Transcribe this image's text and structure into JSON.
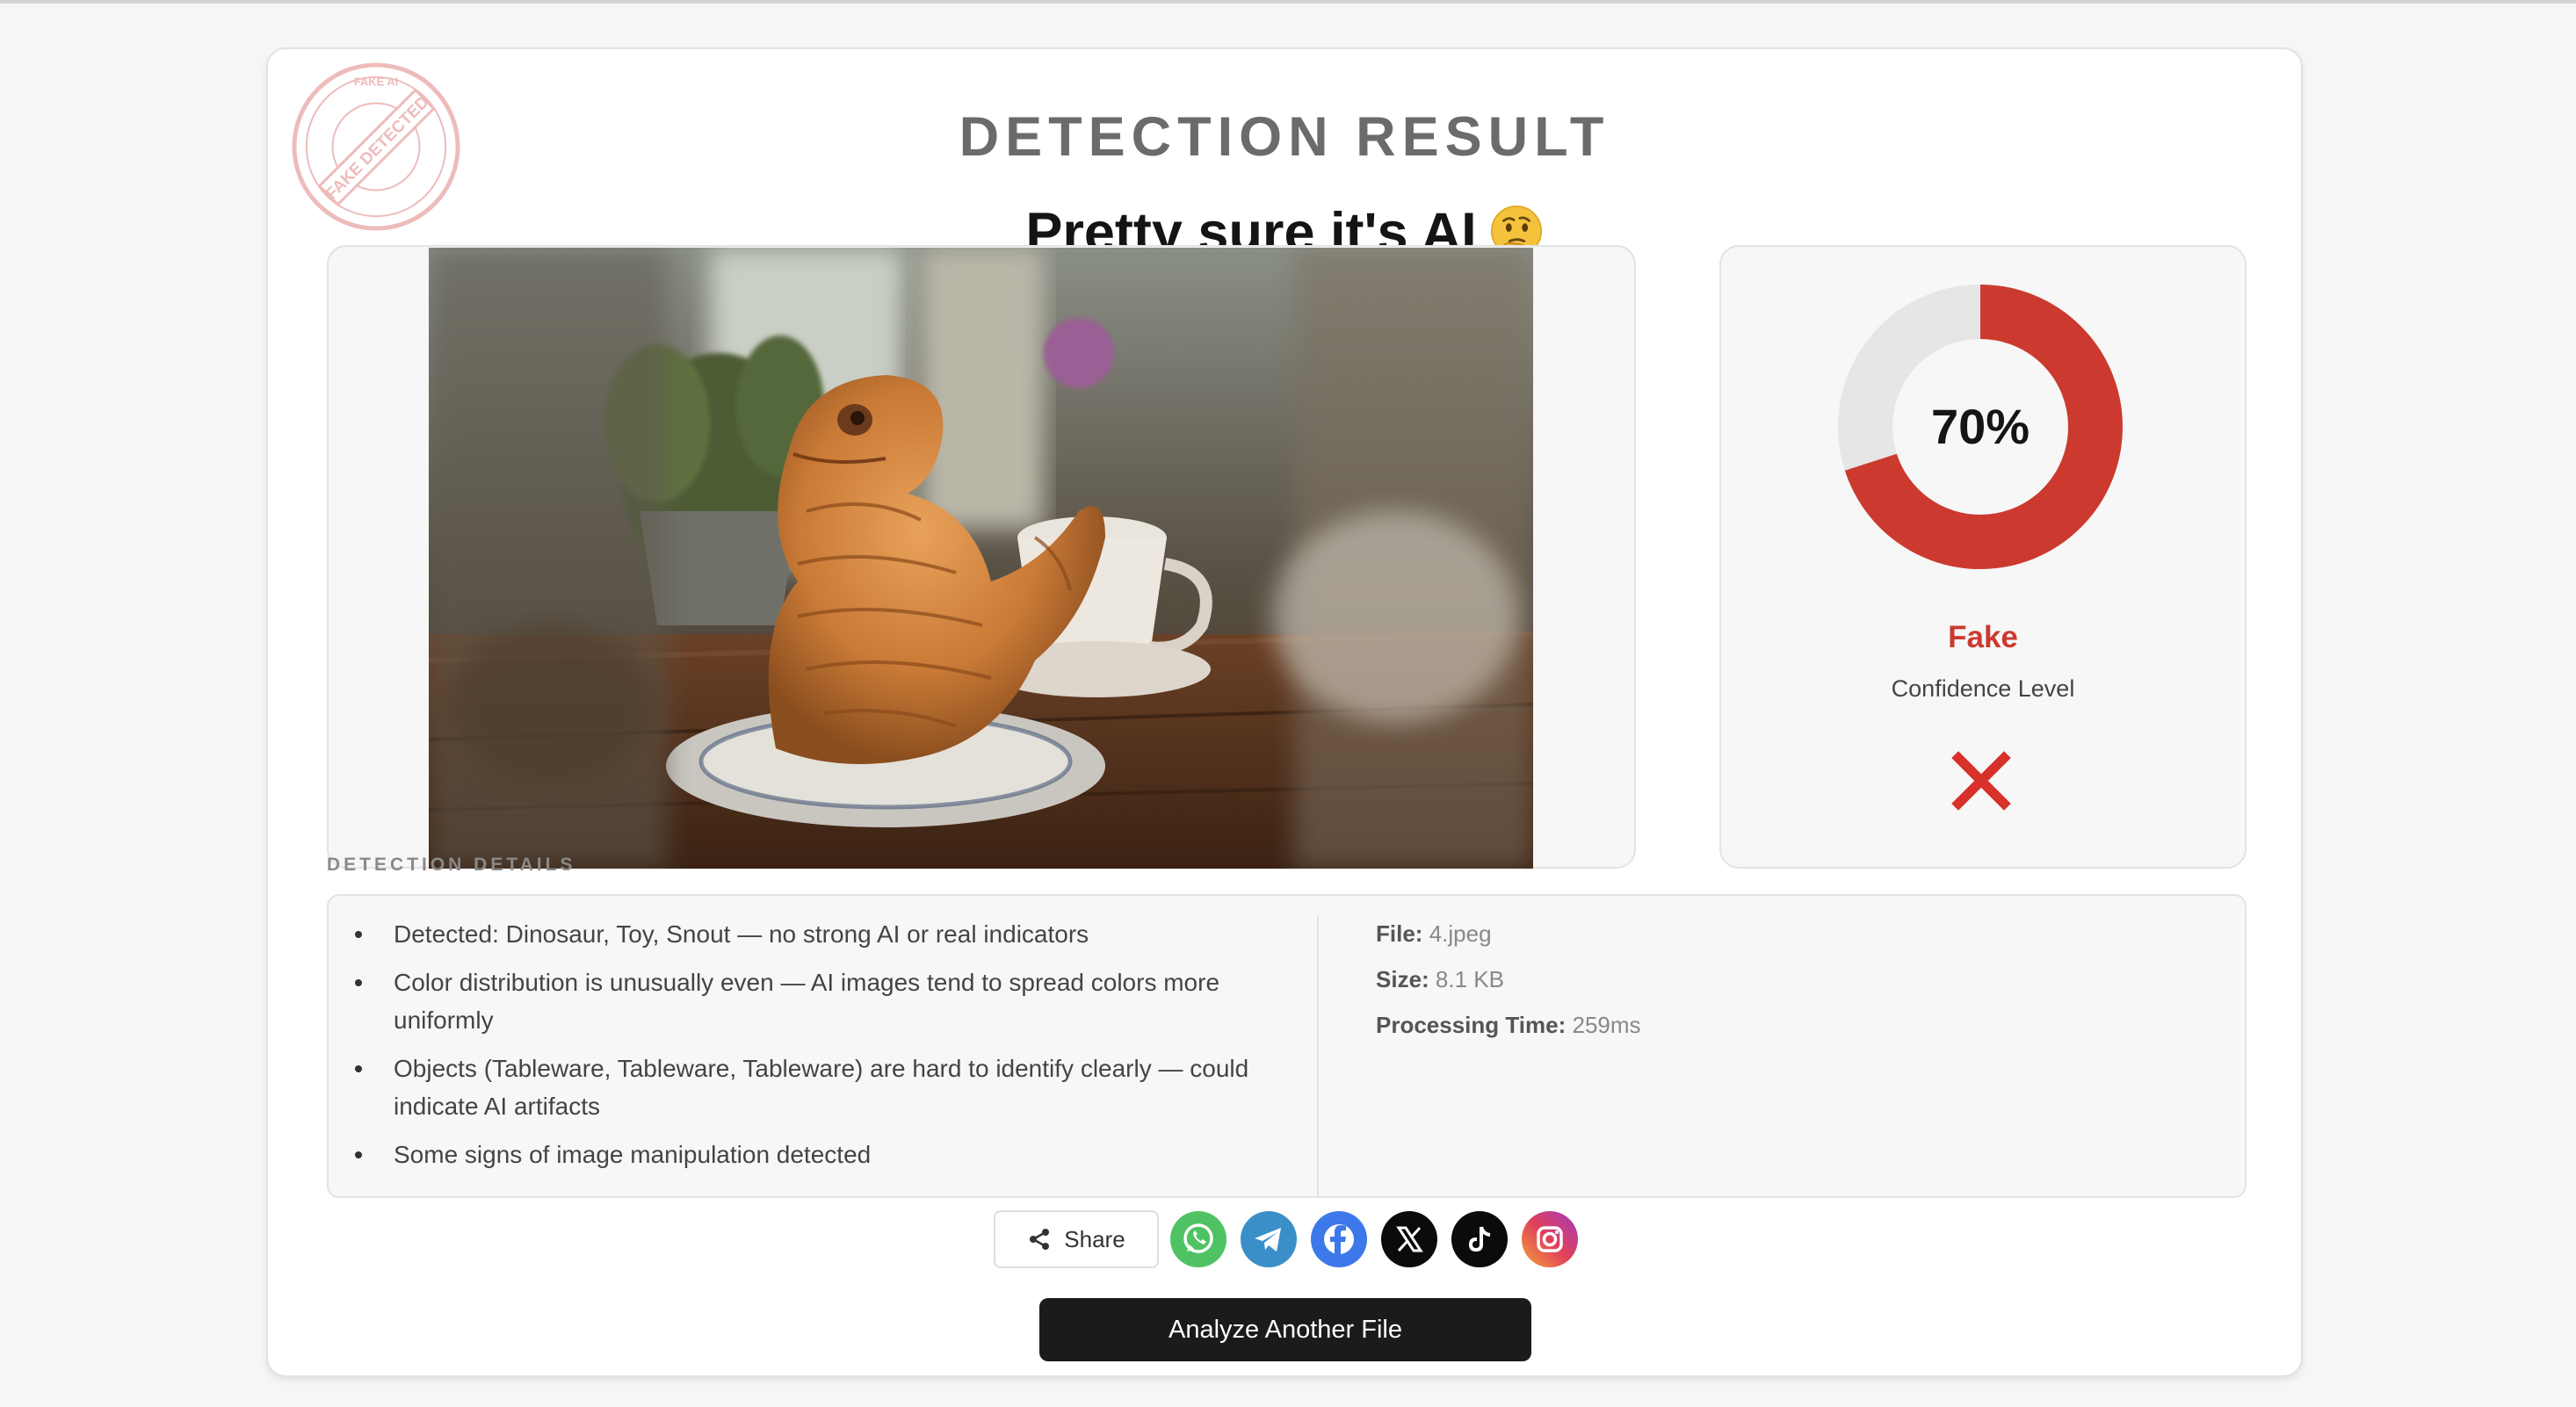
{
  "header": {
    "title": "DETECTION RESULT",
    "verdict": "Pretty sure it's AI"
  },
  "stamp": {
    "text_top": "FAKE AI",
    "text_main": "FAKE DETECTED"
  },
  "confidence": {
    "percent_text": "70%",
    "value": 0.7,
    "label": "Fake",
    "sublabel": "Confidence Level",
    "accent_color": "#cc3a2f",
    "track_color": "#e6e6e6"
  },
  "details": {
    "heading": "DETECTION DETAILS",
    "items": [
      "Detected: Dinosaur, Toy, Snout — no strong AI or real indicators",
      "Color distribution is unusually even — AI images tend to spread colors more uniformly",
      "Objects (Tableware, Tableware, Tableware) are hard to identify clearly — could indicate AI artifacts",
      "Some signs of image manipulation detected"
    ]
  },
  "file": {
    "file_label": "File:",
    "file_value": "4.jpeg",
    "size_label": "Size:",
    "size_value": "8.1 KB",
    "time_label": "Processing Time:",
    "time_value": "259ms"
  },
  "share": {
    "label": "Share",
    "networks": [
      "whatsapp-icon",
      "telegram-icon",
      "facebook-icon",
      "x-icon",
      "tiktok-icon",
      "instagram-icon"
    ]
  },
  "actions": {
    "analyze_label": "Analyze Another File"
  }
}
